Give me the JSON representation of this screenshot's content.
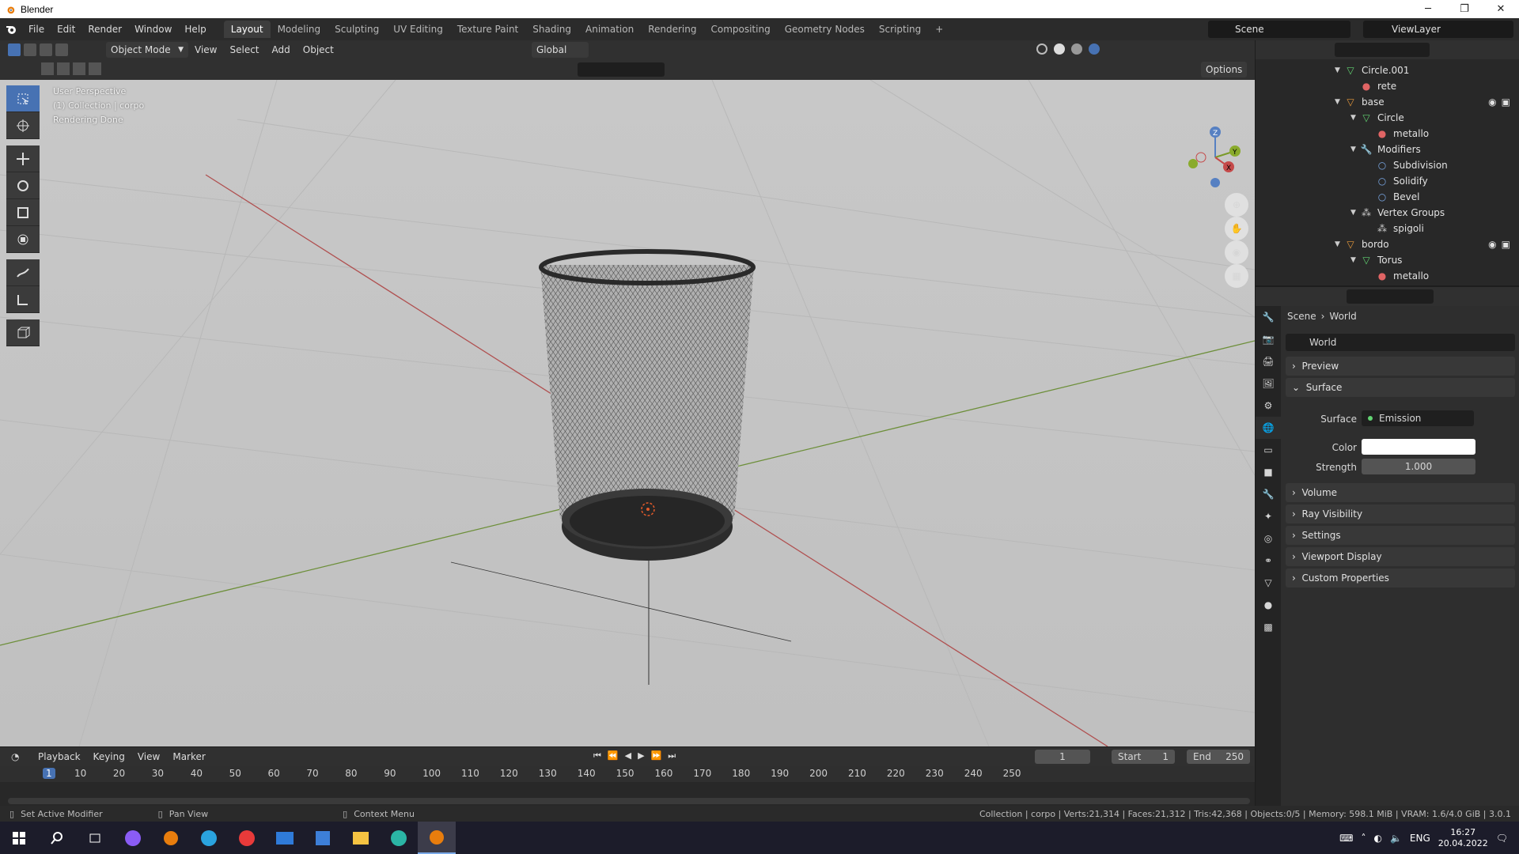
{
  "window": {
    "title": "Blender"
  },
  "menubar": {
    "items": [
      "File",
      "Edit",
      "Render",
      "Window",
      "Help"
    ],
    "workspaces": [
      "Layout",
      "Modeling",
      "Sculpting",
      "UV Editing",
      "Texture Paint",
      "Shading",
      "Animation",
      "Rendering",
      "Compositing",
      "Geometry Nodes",
      "Scripting"
    ],
    "active_workspace": "Layout",
    "add_tab": "+",
    "scene": "Scene",
    "view_layer": "ViewLayer"
  },
  "viewport": {
    "mode": "Object Mode",
    "menus": [
      "View",
      "Select",
      "Add",
      "Object"
    ],
    "orientation": "Global",
    "options_label": "Options",
    "overlay_lines": [
      "User Perspective",
      "(1) Collection | corpo",
      "Rendering Done"
    ],
    "gizmo_axes": {
      "z": "Z",
      "y": "Y",
      "x": "X"
    },
    "colors": {
      "background": "#c4c4c4",
      "x_axis": "#b05050",
      "y_axis": "#6d8f3a"
    }
  },
  "outliner": {
    "rows": [
      {
        "label": "Circle.001",
        "icon": "mesh-data-icon",
        "expanded": true,
        "indent": 0
      },
      {
        "label": "rete",
        "icon": "material-icon",
        "indent": 1
      },
      {
        "label": "base",
        "icon": "object-icon",
        "expanded": true,
        "indent": 0,
        "visible": true
      },
      {
        "label": "Circle",
        "icon": "mesh-data-icon",
        "expanded": true,
        "indent": 1
      },
      {
        "label": "metallo",
        "icon": "material-icon",
        "indent": 2
      },
      {
        "label": "Modifiers",
        "icon": "wrench-icon",
        "expanded": true,
        "indent": 1
      },
      {
        "label": "Subdivision",
        "icon": "modifier-icon",
        "indent": 2
      },
      {
        "label": "Solidify",
        "icon": "modifier-icon",
        "indent": 2
      },
      {
        "label": "Bevel",
        "icon": "modifier-icon",
        "indent": 2
      },
      {
        "label": "Vertex Groups",
        "icon": "vertex-group-icon",
        "expanded": true,
        "indent": 1
      },
      {
        "label": "spigoli",
        "icon": "vertex-group-icon",
        "indent": 2
      },
      {
        "label": "bordo",
        "icon": "object-icon",
        "expanded": true,
        "indent": 0,
        "visible": true
      },
      {
        "label": "Torus",
        "icon": "mesh-data-icon",
        "expanded": true,
        "indent": 1
      },
      {
        "label": "metallo",
        "icon": "material-icon",
        "indent": 2
      }
    ]
  },
  "properties": {
    "breadcrumb": [
      "Scene",
      "World"
    ],
    "datablock": "World",
    "panels": {
      "preview": "Preview",
      "surface": "Surface",
      "volume": "Volume",
      "ray_visibility": "Ray Visibility",
      "settings": "Settings",
      "viewport_display": "Viewport Display",
      "custom_properties": "Custom Properties"
    },
    "surface_field_label": "Surface",
    "surface_value": "Emission",
    "color_label": "Color",
    "color_value": "#ffffff",
    "strength_label": "Strength",
    "strength_value": "1.000"
  },
  "timeline": {
    "menus": [
      "Playback",
      "Keying",
      "View",
      "Marker"
    ],
    "current_frame": "1",
    "start_label": "Start",
    "start_value": "1",
    "end_label": "End",
    "end_value": "250",
    "ruler": [
      "1",
      "10",
      "20",
      "30",
      "40",
      "50",
      "60",
      "70",
      "80",
      "90",
      "100",
      "110",
      "120",
      "130",
      "140",
      "150",
      "160",
      "170",
      "180",
      "190",
      "200",
      "210",
      "220",
      "230",
      "240",
      "250"
    ]
  },
  "statusbar": {
    "left1": "Set Active Modifier",
    "left2": "Pan View",
    "left3": "Context Menu",
    "right": "Collection | corpo | Verts:21,314 | Faces:21,312 | Tris:42,368 | Objects:0/5 | Memory: 598.1 MiB | VRAM: 1.6/4.0 GiB | 3.0.1"
  },
  "taskbar": {
    "lang": "ENG",
    "time": "16:27",
    "date": "20.04.2022"
  }
}
